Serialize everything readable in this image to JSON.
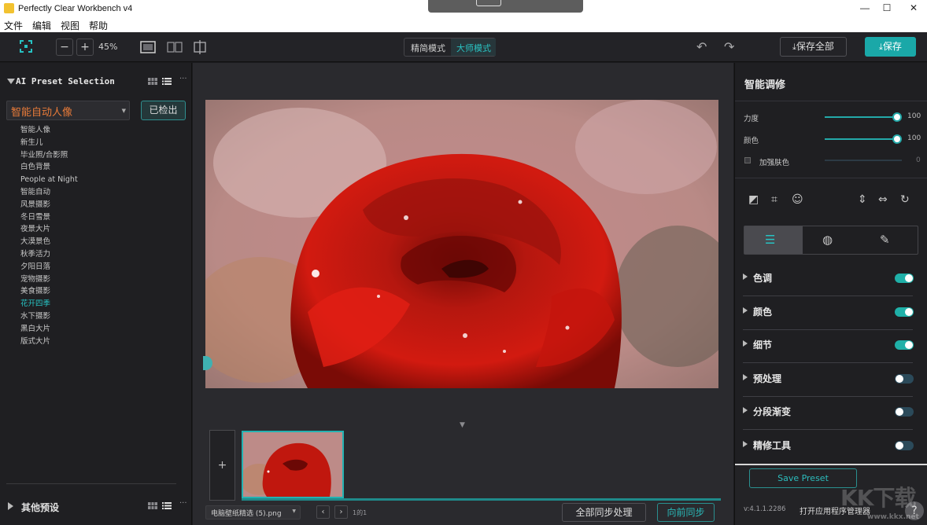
{
  "window": {
    "title": "Perfectly Clear Workbench v4",
    "minimize": "—",
    "maximize": "☐",
    "close": "✕"
  },
  "menu": [
    "文件",
    "编辑",
    "视图",
    "帮助"
  ],
  "toolbar": {
    "zoom_out": "−",
    "zoom_in": "+",
    "zoom_level": "45%",
    "mode_simple": "精简模式",
    "mode_master": "大师模式",
    "save_all": "保存全部",
    "save": "保存"
  },
  "left_panel": {
    "title": "AI Preset Selection",
    "selected_preset": "智能自动人像",
    "detected_button": "已检出",
    "presets": [
      "智能人像",
      "新生儿",
      "毕业照/合影照",
      "白色背景",
      "People at Night",
      "智能自动",
      "风景摄影",
      "冬日雪景",
      "夜景大片",
      "大漠景色",
      "秋季活力",
      "夕阳日落",
      "宠物摄影",
      "美食摄影",
      "花开四季",
      "水下摄影",
      "黑白大片",
      "版式大片"
    ],
    "active_preset": "花开四季",
    "other_presets": "其他预设"
  },
  "center": {
    "file_name": "电脑壁纸精选 (5).png",
    "page_count": "1的1",
    "sync_all": "全部同步处理",
    "sync_prev": "向前同步",
    "add_label": "+"
  },
  "right_panel": {
    "title": "智能调修",
    "sliders": [
      {
        "label": "力度",
        "value": "100",
        "level": 1.0
      },
      {
        "label": "颜色",
        "value": "100",
        "level": 1.0
      }
    ],
    "checkbox": {
      "label": "加强肤色",
      "value": "0",
      "checked": false
    },
    "sections": [
      {
        "label": "色调",
        "enabled": true
      },
      {
        "label": "颜色",
        "enabled": true
      },
      {
        "label": "细节",
        "enabled": true
      },
      {
        "label": "预处理",
        "enabled": false
      },
      {
        "label": "分段渐变",
        "enabled": false
      },
      {
        "label": "精修工具",
        "enabled": false
      }
    ],
    "save_preset": "Save Preset",
    "version": "v:4.1.1.2286",
    "open_manager": "打开应用程序管理器",
    "help": "?"
  },
  "watermark": {
    "main": "KK下载",
    "sub": "www.kkx.net"
  },
  "colors": {
    "accent": "#1aa8a8",
    "active_preset": "#27c3c3",
    "preset_select_text": "#e97b39"
  }
}
